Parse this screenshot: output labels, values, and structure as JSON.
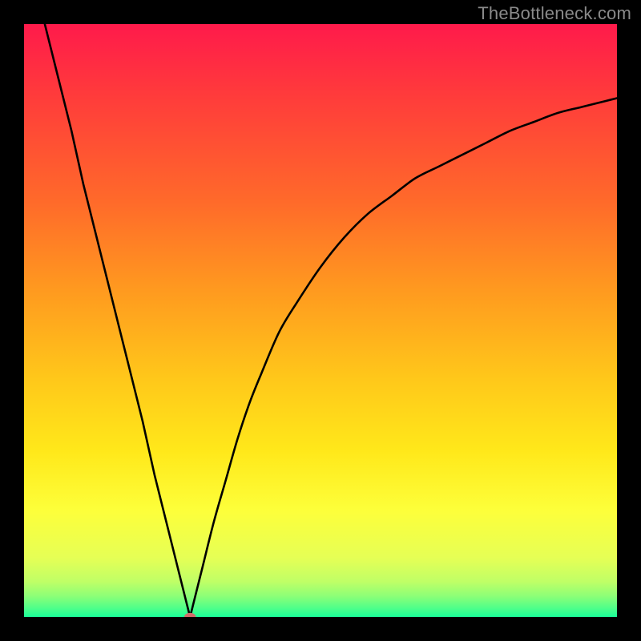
{
  "watermark": "TheBottleneck.com",
  "chart_data": {
    "type": "line",
    "title": "",
    "xlabel": "",
    "ylabel": "",
    "xlim": [
      0,
      100
    ],
    "ylim": [
      0,
      100
    ],
    "background_gradient_stops": [
      {
        "offset": 0.0,
        "color": "#ff1a4b"
      },
      {
        "offset": 0.12,
        "color": "#ff3b3b"
      },
      {
        "offset": 0.3,
        "color": "#ff6a2a"
      },
      {
        "offset": 0.45,
        "color": "#ff9a1f"
      },
      {
        "offset": 0.6,
        "color": "#ffc81a"
      },
      {
        "offset": 0.72,
        "color": "#ffe81a"
      },
      {
        "offset": 0.82,
        "color": "#fdff3a"
      },
      {
        "offset": 0.9,
        "color": "#e6ff55"
      },
      {
        "offset": 0.94,
        "color": "#c0ff66"
      },
      {
        "offset": 0.965,
        "color": "#8cff77"
      },
      {
        "offset": 0.985,
        "color": "#4fff8a"
      },
      {
        "offset": 1.0,
        "color": "#1aff99"
      }
    ],
    "vertex": {
      "x": 28,
      "y": 0
    },
    "marker": {
      "x": 28,
      "y": 0,
      "rx": 7,
      "ry": 5,
      "fill": "#d46a6a"
    },
    "series": [
      {
        "name": "left-branch",
        "x": [
          0,
          2,
          4,
          6,
          8,
          10,
          12,
          14,
          16,
          18,
          20,
          22,
          24,
          26,
          28
        ],
        "y": [
          114,
          106,
          98,
          90,
          82,
          73,
          65,
          57,
          49,
          41,
          33,
          24,
          16,
          8,
          0
        ]
      },
      {
        "name": "right-branch",
        "x": [
          28,
          30,
          32,
          34,
          36,
          38,
          40,
          43,
          46,
          50,
          54,
          58,
          62,
          66,
          70,
          74,
          78,
          82,
          86,
          90,
          94,
          98,
          100
        ],
        "y": [
          0,
          8,
          16,
          23,
          30,
          36,
          41,
          48,
          53,
          59,
          64,
          68,
          71,
          74,
          76,
          78,
          80,
          82,
          83.5,
          85,
          86,
          87,
          87.5
        ]
      }
    ]
  }
}
